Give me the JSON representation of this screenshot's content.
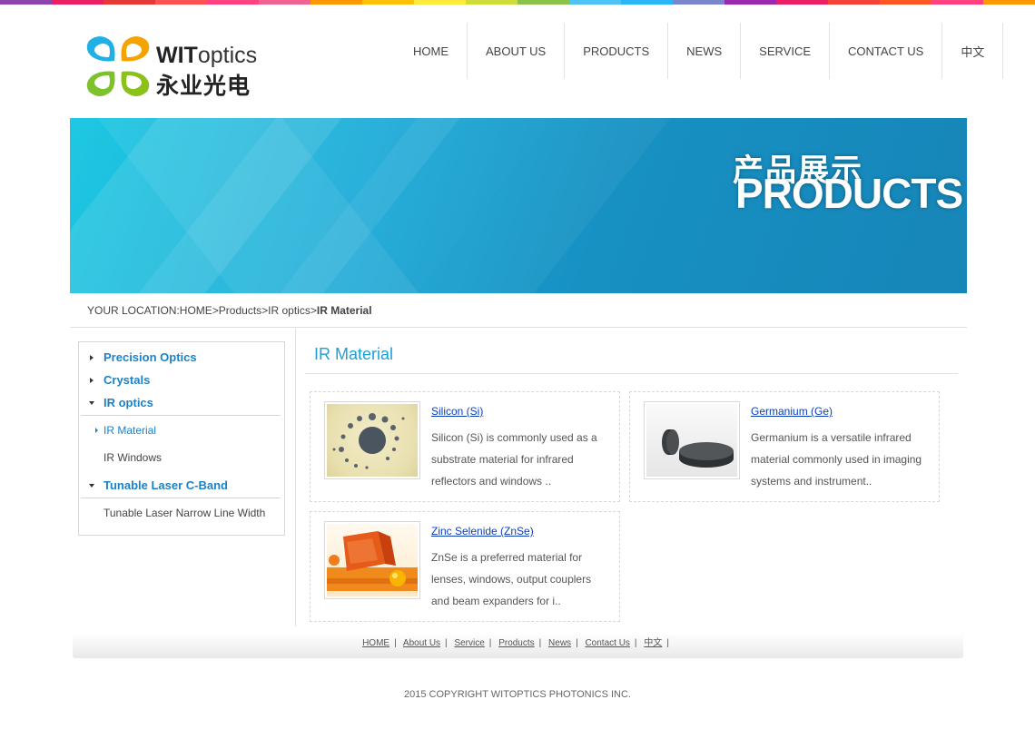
{
  "header": {
    "logo_brand_bold": "WIT",
    "logo_brand_rest": "optics",
    "logo_cn": "永业光电",
    "nav": [
      "HOME",
      "ABOUT US",
      "PRODUCTS",
      "NEWS",
      "SERVICE",
      "CONTACT US",
      "中文"
    ]
  },
  "banner": {
    "cn": "产品展示",
    "en": "PRODUCTS"
  },
  "breadcrumb": {
    "prefix": "YOUR LOCATION:HOME>Products>IR optics>",
    "current": "IR Material"
  },
  "sidebar": {
    "items": [
      {
        "label": "Precision Optics"
      },
      {
        "label": "Crystals"
      },
      {
        "label": "IR optics"
      },
      {
        "label": "IR Material"
      },
      {
        "label": "IR Windows"
      },
      {
        "label": "Tunable Laser C-Band"
      },
      {
        "label": "Tunable Laser Narrow Line Width"
      }
    ]
  },
  "content": {
    "title": "IR Material",
    "products": [
      {
        "name": "Silicon (Si)",
        "desc": "Silicon (Si) is commonly used as a substrate material for infrared reflectors and windows .."
      },
      {
        "name": "Germanium (Ge)",
        "desc": "Germanium is a versatile infrared material commonly used in imaging systems and instrument.."
      },
      {
        "name": "Zinc Selenide (ZnSe)",
        "desc": "ZnSe is a preferred material for lenses, windows, output couplers and beam expanders for i.."
      }
    ]
  },
  "footer": {
    "links": [
      "HOME",
      "About Us",
      "Service",
      "Products",
      "News",
      "Contact Us",
      "中文"
    ],
    "copyright": "2015 COPYRIGHT WITOPTICS PHOTONICS INC."
  },
  "colors": {
    "accent": "#1ba0d8",
    "sidebar_link": "#1a82c8",
    "product_link": "#0b3fb8",
    "banner": "#1790c2"
  }
}
